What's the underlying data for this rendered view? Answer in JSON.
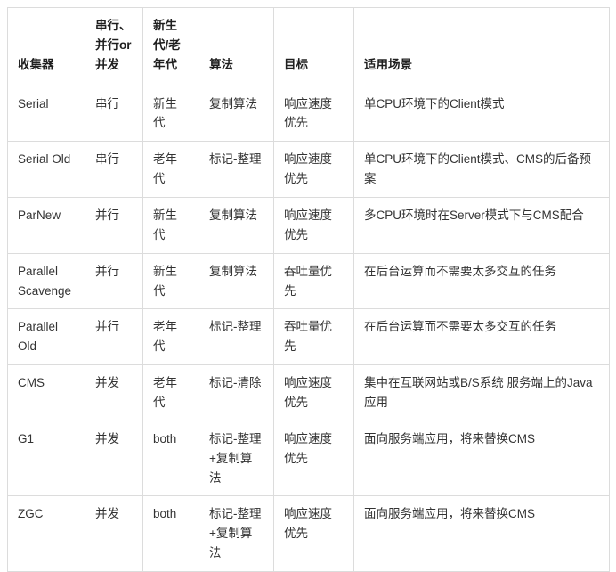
{
  "table": {
    "name": "gc-collector-comparison-table",
    "columns": [
      {
        "key": "collector",
        "label": "收集器"
      },
      {
        "key": "concurrency",
        "label": "串行、并行or并发"
      },
      {
        "key": "generation",
        "label": "新生代/老年代"
      },
      {
        "key": "algorithm",
        "label": "算法"
      },
      {
        "key": "goal",
        "label": "目标"
      },
      {
        "key": "scenario",
        "label": "适用场景"
      }
    ],
    "rows": [
      {
        "collector": "Serial",
        "concurrency": "串行",
        "generation": "新生代",
        "algorithm": "复制算法",
        "goal": "响应速度优先",
        "scenario": "单CPU环境下的Client模式"
      },
      {
        "collector": "Serial Old",
        "concurrency": "串行",
        "generation": "老年代",
        "algorithm": "标记-整理",
        "goal": "响应速度优先",
        "scenario": "单CPU环境下的Client模式、CMS的后备预案"
      },
      {
        "collector": "ParNew",
        "concurrency": "并行",
        "generation": "新生代",
        "algorithm": "复制算法",
        "goal": "响应速度优先",
        "scenario": "多CPU环境时在Server模式下与CMS配合"
      },
      {
        "collector": "Parallel Scavenge",
        "concurrency": "并行",
        "generation": "新生代",
        "algorithm": "复制算法",
        "goal": "吞吐量优先",
        "scenario": "在后台运算而不需要太多交互的任务"
      },
      {
        "collector": "Parallel Old",
        "concurrency": "并行",
        "generation": "老年代",
        "algorithm": "标记-整理",
        "goal": "吞吐量优先",
        "scenario": "在后台运算而不需要太多交互的任务"
      },
      {
        "collector": "CMS",
        "concurrency": "并发",
        "generation": "老年代",
        "algorithm": "标记-清除",
        "goal": "响应速度优先",
        "scenario": "集中在互联网站或B/S系统 服务端上的Java应用"
      },
      {
        "collector": "G1",
        "concurrency": "并发",
        "generation": "both",
        "algorithm": "标记-整理+复制算法",
        "goal": "响应速度优先",
        "scenario": "面向服务端应用，将来替换CMS"
      },
      {
        "collector": "ZGC",
        "concurrency": "并发",
        "generation": "both",
        "algorithm": "标记-整理+复制算法",
        "goal": "响应速度优先",
        "scenario": "面向服务端应用，将来替换CMS"
      }
    ]
  },
  "colors": {
    "border": "#dcdcdc",
    "background": "#ffffff",
    "header_text": "#1f1f1f",
    "body_text": "#333333"
  }
}
